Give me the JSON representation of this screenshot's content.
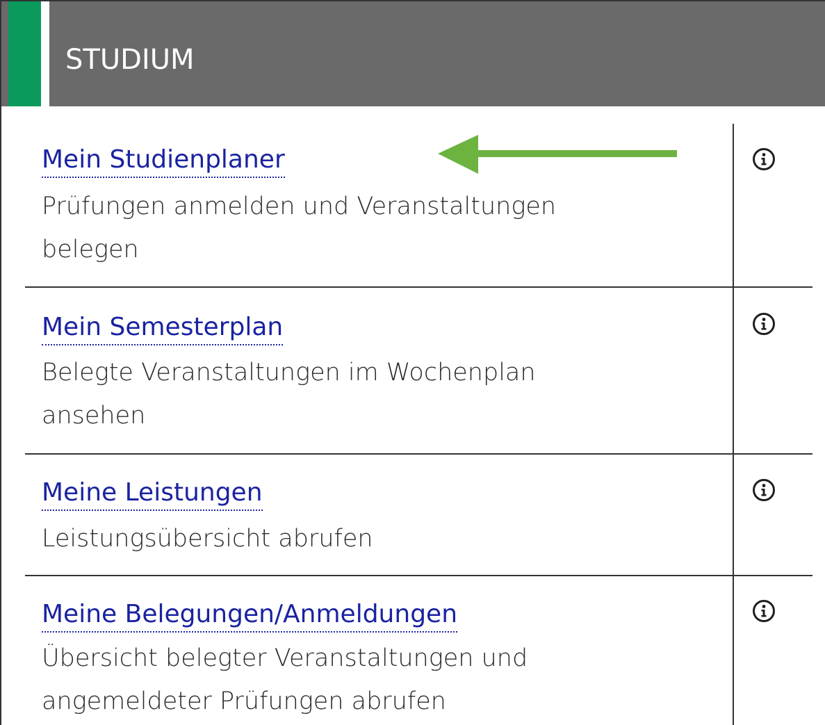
{
  "header": {
    "title": "STUDIUM",
    "accent_color": "#0a9a5c",
    "background_color": "#6a6a6a"
  },
  "items": [
    {
      "title": "Mein Studienplaner",
      "desc_lines": [
        "Prüfungen anmelden und Veranstaltungen",
        "belegen"
      ],
      "info_icon": "info-circle-icon"
    },
    {
      "title": "Mein Semesterplan",
      "desc_lines": [
        "Belegte Veranstaltungen im Wochenplan",
        "ansehen"
      ],
      "info_icon": "info-circle-icon"
    },
    {
      "title": "Meine Leistungen",
      "desc_lines": [
        "Leistungsübersicht abrufen"
      ],
      "info_icon": "info-circle-icon"
    },
    {
      "title": "Meine Belegungen/Anmeldungen",
      "desc_lines": [
        "Übersicht belegter Veranstaltungen und",
        "angemeldeter Prüfungen abrufen"
      ],
      "info_icon": "info-circle-icon"
    }
  ],
  "annotation": {
    "icon": "arrow-left-icon",
    "color": "#6db33f"
  },
  "colors": {
    "link": "#1a23a0",
    "text": "#2b2b2b",
    "divider": "#333333"
  }
}
